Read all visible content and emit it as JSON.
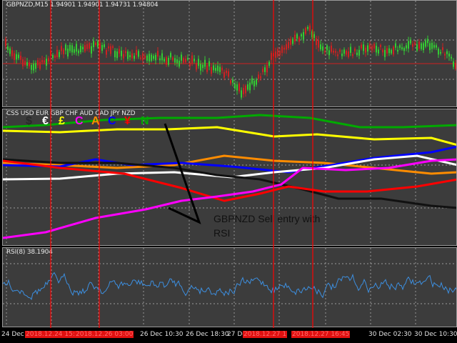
{
  "price_panel": {
    "label": "GBPNZD,M15  1.94901 1.94901 1.94731 1.94804"
  },
  "css_panel": {
    "label": "CSS USD EUR GBP CHF AUD CAD JPY NZD",
    "currency_letters": [
      {
        "char": "$",
        "color": "#2a2a2a"
      },
      {
        "char": "€",
        "color": "#ffffff"
      },
      {
        "char": "£",
        "color": "#ffff00"
      },
      {
        "char": "C",
        "color": "#ff00ff"
      },
      {
        "char": "A",
        "color": "#ff8c00"
      },
      {
        "char": "C",
        "color": "#0000ff"
      },
      {
        "char": "¥",
        "color": "#ff0000"
      },
      {
        "char": "N",
        "color": "#00aa00"
      }
    ],
    "annotation_line1": "GBPNZD Sell entry with",
    "annotation_line2": "RSI"
  },
  "rsi_panel": {
    "label": "RSI(8) 38.1904"
  },
  "time_axis": [
    {
      "text": "24 Dec 2018",
      "highlight": false
    },
    {
      "text": "2018.12.24 15:00",
      "highlight": true
    },
    {
      "text": "2018.12.26 03:00",
      "highlight": true
    },
    {
      "text": "26 Dec 10:30",
      "highlight": false
    },
    {
      "text": "26 Dec 18:30",
      "highlight": false
    },
    {
      "text": "27 Dec",
      "highlight": false
    },
    {
      "text": "2018.12.27 1",
      "highlight": true
    },
    {
      "text": "2018.12.27 16:45",
      "highlight": true
    },
    {
      "text": "30 Dec 02:30",
      "highlight": false
    },
    {
      "text": "30 Dec 10:30",
      "highlight": false
    }
  ],
  "colors": {
    "vline": "#ff0000",
    "bull_candle": "#33cc33",
    "bear_candle": "#cc2222",
    "rsi_line": "#3c8fe0"
  }
}
